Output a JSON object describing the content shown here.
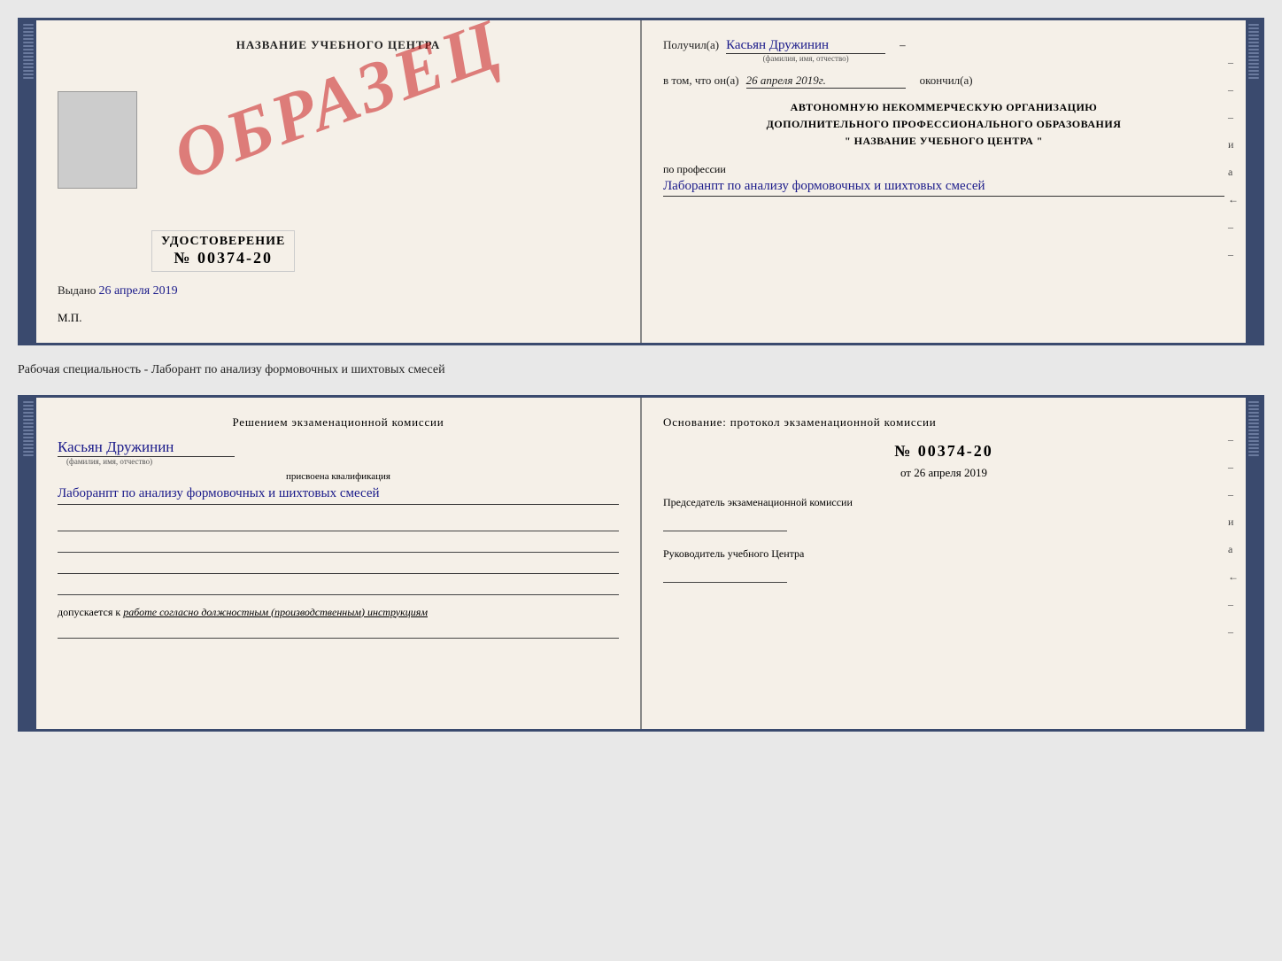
{
  "top_doc": {
    "left": {
      "title": "НАЗВАНИЕ УЧЕБНОГО ЦЕНТРА",
      "stamp_text": "ОБРАЗЕЦ",
      "udostoverenie": "УДОСТОВЕРЕНИЕ",
      "number": "№ 00374-20",
      "vydano_label": "Выдано",
      "vydano_date": "26 апреля 2019",
      "mp_label": "М.П."
    },
    "right": {
      "poluchil_label": "Получил(а)",
      "poluchil_value": "Касьян Дружинин",
      "fio_small": "(фамилия, имя, отчество)",
      "vtom_label": "в том, что он(а)",
      "date_value": "26 апреля 2019г.",
      "okончил_label": "окончил(а)",
      "org_line1": "АВТОНОМНУЮ НЕКОММЕРЧЕСКУЮ ОРГАНИЗАЦИЮ",
      "org_line2": "ДОПОЛНИТЕЛЬНОГО ПРОФЕССИОНАЛЬНОГО ОБРАЗОВАНИЯ",
      "org_line3": "\"   НАЗВАНИЕ УЧЕБНОГО ЦЕНТРА   \"",
      "po_professii": "по профессии",
      "profession_value": "Лаборанпт по анализу формовочных и шихтовых смесей",
      "side_dashes": [
        "-",
        "-",
        "-",
        "и",
        "а",
        "←",
        "-",
        "-"
      ]
    }
  },
  "middle_text": "Рабочая специальность - Лаборант по анализу формовочных и шихтовых смесей",
  "bottom_doc": {
    "left": {
      "resheniye_title": "Решением  экзаменационной  комиссии",
      "name_value": "Касьян Дружинин",
      "fio_small": "(фамилия, имя, отчество)",
      "prisvoena_label": "присвоена квалификация",
      "kval_value": "Лаборанпт по анализу формовочных и шихтовых смесей",
      "dopuskaetsya_label": "допускается к",
      "dopusk_text": "работе согласно должностным (производственным) инструкциям"
    },
    "right": {
      "osnovaniye_title": "Основание: протокол экзаменационной  комиссии",
      "number": "№  00374-20",
      "ot_label": "от",
      "ot_date": "26 апреля 2019",
      "predsedatel_label": "Председатель экзаменационной комиссии",
      "rukovoditel_label": "Руководитель учебного Центра",
      "side_items": [
        "-",
        "-",
        "-",
        "и",
        "а",
        "←",
        "-",
        "-"
      ]
    }
  }
}
